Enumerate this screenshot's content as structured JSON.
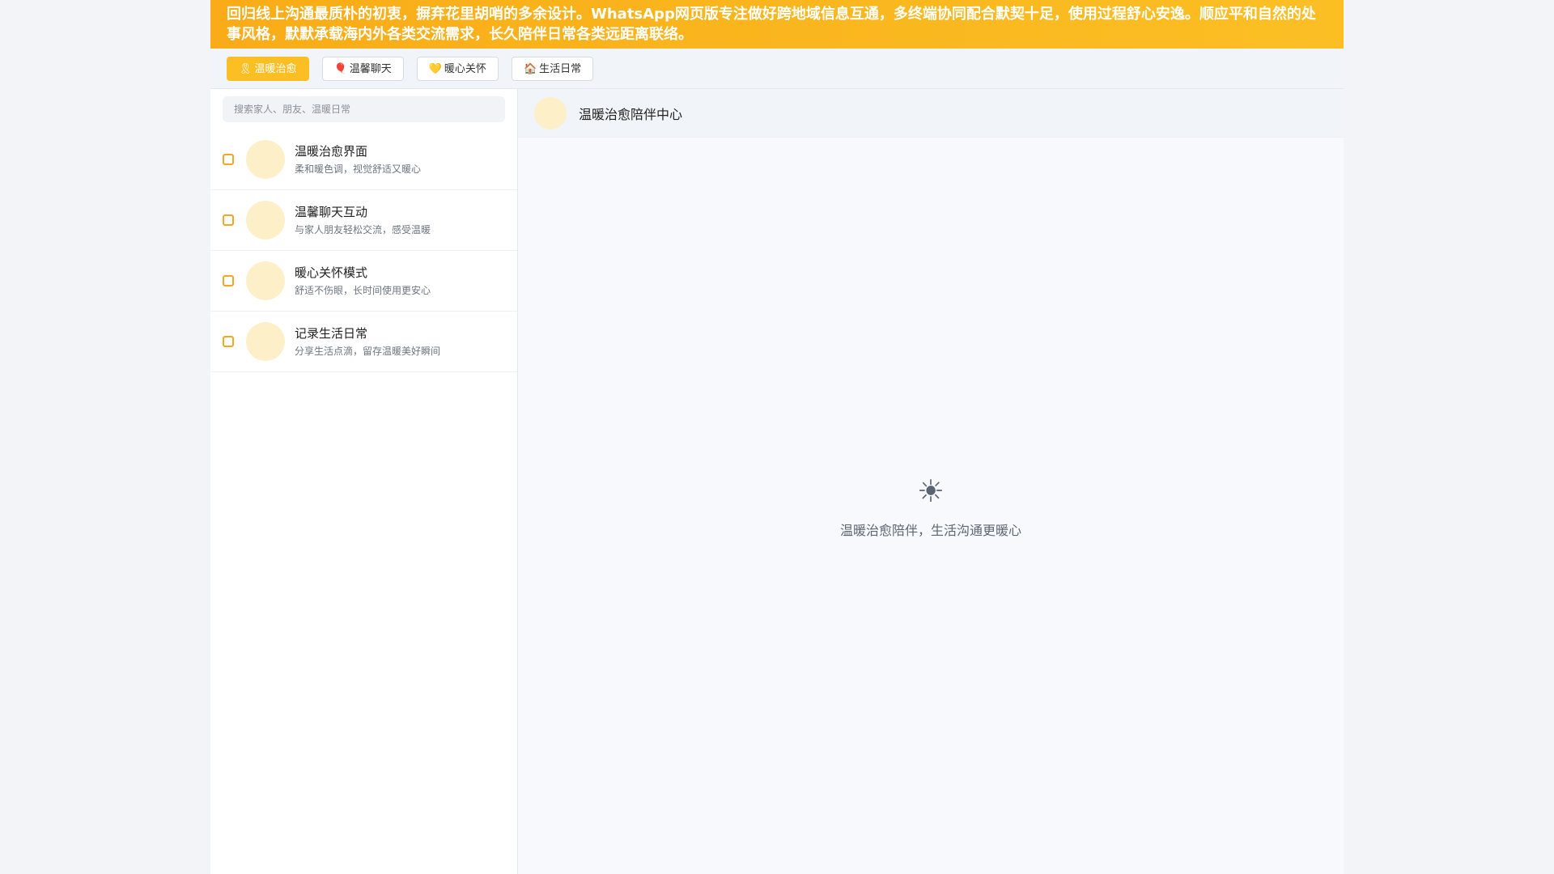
{
  "banner": {
    "text": "回归线上沟通最质朴的初衷，摒弃花里胡哨的多余设计。WhatsApp网页版专注做好跨地域信息互通，多终端协同配合默契十足，使用过程舒心安逸。顺应平和自然的处事风格，默默承载海内外各类交流需求，长久陪伴日常各类远距离联络。"
  },
  "tabs": [
    {
      "icon": "🎗",
      "label": "温暖治愈",
      "active": true
    },
    {
      "icon": "🎈",
      "label": "温馨聊天",
      "active": false
    },
    {
      "icon": "💛",
      "label": "暖心关怀",
      "active": false
    },
    {
      "icon": "🏠",
      "label": "生活日常",
      "active": false
    }
  ],
  "search": {
    "placeholder": "搜索家人、朋友、温暖日常"
  },
  "list": [
    {
      "title": "温暖治愈界面",
      "subtitle": "柔和暖色调，视觉舒适又暖心"
    },
    {
      "title": "温馨聊天互动",
      "subtitle": "与家人朋友轻松交流，感受温暖"
    },
    {
      "title": "暖心关怀模式",
      "subtitle": "舒适不伤眼，长时间使用更安心"
    },
    {
      "title": "记录生活日常",
      "subtitle": "分享生活点滴，留存温暖美好瞬间"
    }
  ],
  "chat": {
    "title": "温暖治愈陪伴中心"
  },
  "empty": {
    "icon": "☀",
    "text": "温暖治愈陪伴，生活沟通更暖心"
  },
  "colors": {
    "accent": "#fbbf24",
    "avatar": "#fdf0c9",
    "checkbox": "#f5a623"
  }
}
